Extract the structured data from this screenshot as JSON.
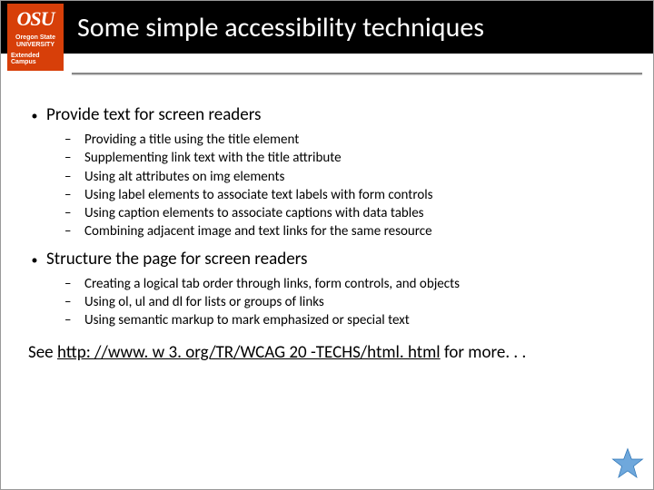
{
  "logo": {
    "osu": "OSU",
    "univ_line1": "Oregon State",
    "univ_line2": "UNIVERSITY",
    "ext": "Extended Campus"
  },
  "title": "Some simple accessibility techniques",
  "bullets": [
    {
      "label": "Provide text for screen readers",
      "items": [
        "Providing a title using the title element",
        "Supplementing link text with the title attribute",
        "Using alt attributes on img elements",
        "Using label elements to associate text labels with form controls",
        "Using caption elements to associate captions with data tables",
        "Combining adjacent image and text links for the same resource"
      ]
    },
    {
      "label": "Structure the page for screen readers",
      "items": [
        "Creating a logical tab order through links, form controls, and objects",
        "Using ol, ul and dl for lists or groups of links",
        "Using semantic markup to mark emphasized or special text"
      ]
    }
  ],
  "footer": {
    "prefix": "See ",
    "link": "http: //www. w 3. org/TR/WCAG 20 -TECHS/html. html",
    "suffix": " for more. . ."
  },
  "colors": {
    "brand_orange": "#d73f09",
    "header_bg": "#000000"
  }
}
